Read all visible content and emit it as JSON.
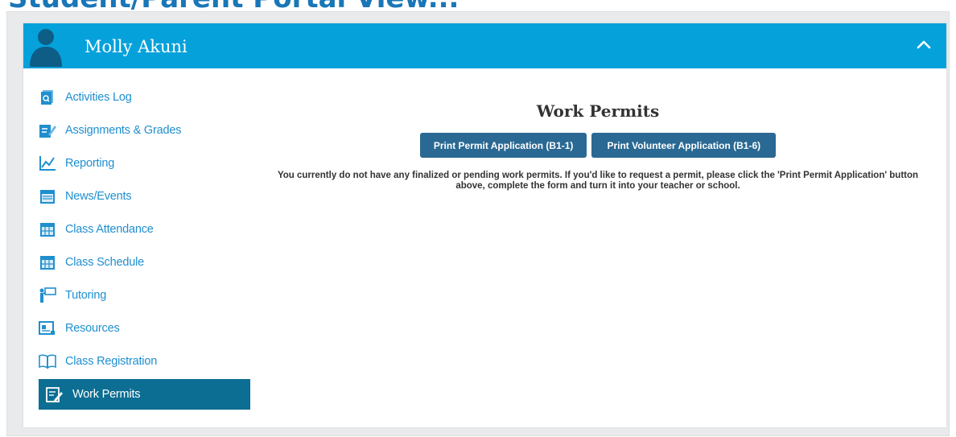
{
  "page_heading": "Student/Parent Portal View...",
  "header": {
    "student_name": "Molly Akuni",
    "avatar_icon": "user-silhouette-icon",
    "collapse_icon": "chevron-up-icon",
    "background_color": "#04a1db"
  },
  "sidebar": {
    "items": [
      {
        "label": "Activities Log",
        "icon": "activity-log-icon",
        "active": false
      },
      {
        "label": "Assignments & Grades",
        "icon": "assignments-pencil-icon",
        "active": false
      },
      {
        "label": "Reporting",
        "icon": "line-chart-icon",
        "active": false
      },
      {
        "label": "News/Events",
        "icon": "news-calendar-icon",
        "active": false
      },
      {
        "label": "Class Attendance",
        "icon": "attendance-calendar-icon",
        "active": false
      },
      {
        "label": "Class Schedule",
        "icon": "schedule-calendar-icon",
        "active": false
      },
      {
        "label": "Tutoring",
        "icon": "tutoring-board-icon",
        "active": false
      },
      {
        "label": "Resources",
        "icon": "resources-document-icon",
        "active": false
      },
      {
        "label": "Class Registration",
        "icon": "open-book-icon",
        "active": false
      },
      {
        "label": "Work Permits",
        "icon": "permit-edit-icon",
        "active": true
      }
    ],
    "active_color": "#0c6e92"
  },
  "content": {
    "title": "Work Permits",
    "buttons": {
      "print_permit": "Print Permit Application (B1-1)",
      "print_volunteer": "Print Volunteer Application (B1-6)"
    },
    "message": "You currently do not have any finalized or pending work permits. If you'd like to request a permit, please click the 'Print Permit Application' button above, complete the form and turn it into your teacher or school."
  }
}
